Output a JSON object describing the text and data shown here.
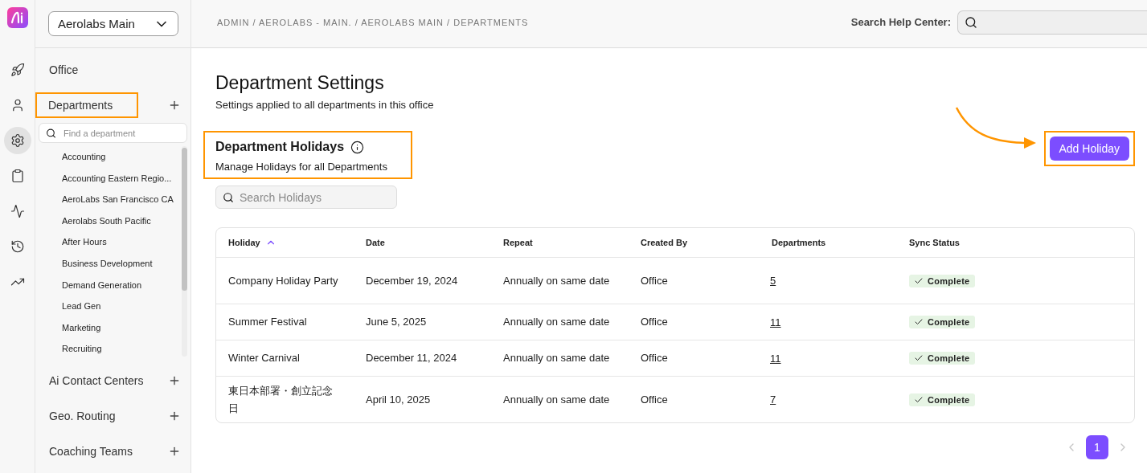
{
  "rail": [
    {
      "selected": false
    },
    {
      "selected": false
    },
    {
      "selected": true
    },
    {
      "selected": false
    },
    {
      "selected": false
    },
    {
      "selected": false
    },
    {
      "selected": false
    }
  ],
  "sidebar": {
    "workspace": "Aerolabs Main",
    "sections": [
      {
        "label": "Office",
        "kind": "link",
        "highlighted": false
      },
      {
        "label": "Departments",
        "kind": "group",
        "highlighted": true,
        "expanded": true,
        "search_placeholder": "Find a department",
        "items": [
          "Accounting",
          "Accounting Eastern Regio...",
          "AeroLabs San Francisco CA",
          "Aerolabs South Pacific",
          "After Hours",
          "Business Development",
          "Demand Generation",
          "Lead Gen",
          "Marketing",
          "Recruiting"
        ]
      },
      {
        "label": "Ai Contact Centers",
        "kind": "group",
        "highlighted": false,
        "expanded": false
      },
      {
        "label": "Geo. Routing",
        "kind": "group",
        "highlighted": false,
        "expanded": false
      },
      {
        "label": "Coaching Teams",
        "kind": "group",
        "highlighted": false,
        "expanded": false
      }
    ]
  },
  "header": {
    "breadcrumb": "ADMIN / AEROLABS - MAIN. / AEROLABS MAIN / DEPARTMENTS",
    "help_label": "Search Help Center:"
  },
  "page": {
    "title": "Department Settings",
    "subtitle": "Settings applied to all departments in this office"
  },
  "holidays": {
    "title": "Department Holidays",
    "description": "Manage Holidays for all Departments",
    "highlighted": true,
    "search_placeholder": "Search Holidays",
    "add_button": {
      "label": "Add Holiday",
      "highlighted": true,
      "callout_arrow": true
    }
  },
  "table": {
    "columns": [
      {
        "label": "Holiday",
        "sorted_ascending": true
      },
      {
        "label": "Date",
        "sorted_ascending": false
      },
      {
        "label": "Repeat",
        "sorted_ascending": false
      },
      {
        "label": "Created By",
        "sorted_ascending": false
      },
      {
        "label": "Departments",
        "sorted_ascending": false
      },
      {
        "label": "Sync Status",
        "sorted_ascending": false
      }
    ],
    "rows": [
      {
        "holiday": "Company Holiday Party",
        "date": "December 19, 2024",
        "repeat": "Annually on same date",
        "created_by": "Office",
        "departments": "5",
        "sync_status": "Complete",
        "synced": true
      },
      {
        "holiday": "Summer Festival",
        "date": "June 5, 2025",
        "repeat": "Annually on same date",
        "created_by": "Office",
        "departments": "11",
        "sync_status": "Complete",
        "synced": true
      },
      {
        "holiday": "Winter Carnival",
        "date": "December 11, 2024",
        "repeat": "Annually on same date",
        "created_by": "Office",
        "departments": "11",
        "sync_status": "Complete",
        "synced": true
      },
      {
        "holiday": "東日本部署・創立記念日",
        "date": "April 10, 2025",
        "repeat": "Annually on same date",
        "created_by": "Office",
        "departments": "7",
        "sync_status": "Complete",
        "synced": true
      }
    ]
  },
  "pagination": {
    "prev_disabled": true,
    "next_disabled": true,
    "pages": [
      {
        "label": "1",
        "selected": true
      }
    ]
  }
}
